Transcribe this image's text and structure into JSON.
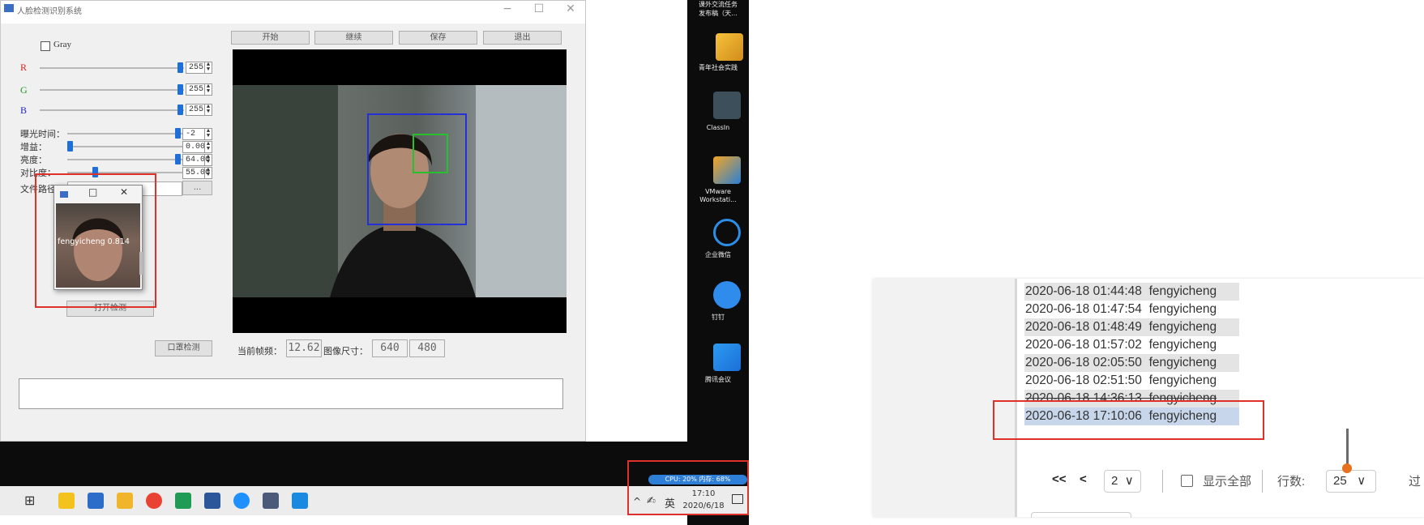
{
  "app_window": {
    "title": "人脸检测识别系统",
    "minimize": "−",
    "maximize": "☐",
    "close": "✕",
    "gray_label": "Gray",
    "r_label": "R",
    "g_label": "G",
    "b_label": "B",
    "r_value": "255",
    "g_value": "255",
    "b_value": "255",
    "exposure_label": "曝光时间：",
    "exposure_value": "-2",
    "gain_label": "增益：",
    "gain_value": "0.00",
    "brightness_label": "亮度：",
    "brightness_value": "64.00",
    "contrast_label": "对比度：",
    "contrast_value": "55.00",
    "filepath_label": "文件路径：",
    "browse_button": "...",
    "buttons": {
      "start": "开始",
      "continue": "继续",
      "save": "保存",
      "exit": "退出"
    },
    "open_button": "打开检测",
    "detect_button": "口罩检测",
    "fps_label": "当前帧频：",
    "fps_value": "12.62",
    "size_label": "图像尺寸：",
    "size_w": "640",
    "size_h": "480",
    "colors": {
      "r": "#d62020",
      "g": "#1a9a1a",
      "b": "#2020c8",
      "accent": "#1e6fd9"
    }
  },
  "popup": {
    "min": "□",
    "close": "✕",
    "caption": "fengyicheng 0.814"
  },
  "desktop": {
    "top_text_1": "课外交流任务",
    "top_text_2": "发布稿（天...",
    "icons": [
      {
        "label": "青年社会实践",
        "icon": "folder-icon"
      },
      {
        "label": "ClassIn",
        "icon": "classin-icon"
      },
      {
        "label": "VMware Workstati...",
        "icon": "vmware-icon"
      },
      {
        "label": "企业微信",
        "icon": "wecom-icon"
      },
      {
        "label": "钉钉",
        "icon": "dingtalk-icon"
      },
      {
        "label": "腾讯会议",
        "icon": "tencent-meeting-icon"
      }
    ],
    "cpu_meter": "CPU: 20%  内存: 68%",
    "tray_chevron": "^",
    "ime": "英",
    "clock_time": "17:10",
    "clock_date": "2020/6/18"
  },
  "web": {
    "rows": [
      {
        "date": "2020-06-18 01:44:48",
        "name": "fengyicheng"
      },
      {
        "date": "2020-06-18 01:47:54",
        "name": "fengyicheng"
      },
      {
        "date": "2020-06-18 01:48:49",
        "name": "fengyicheng"
      },
      {
        "date": "2020-06-18 01:57:02",
        "name": "fengyicheng"
      },
      {
        "date": "2020-06-18 02:05:50",
        "name": "fengyicheng"
      },
      {
        "date": "2020-06-18 02:51:50",
        "name": "fengyicheng"
      },
      {
        "date": "2020-06-18 14:36:13",
        "name": "fengyicheng"
      },
      {
        "date": "2020-06-18 17:10:06",
        "name": "fengyicheng"
      }
    ],
    "first_page": "<<",
    "prev_page": "<",
    "page_value": "2",
    "show_all": "显示全部",
    "rows_label": "行数:",
    "rows_value": "25",
    "chevron": "∨",
    "cut_text": "过"
  }
}
